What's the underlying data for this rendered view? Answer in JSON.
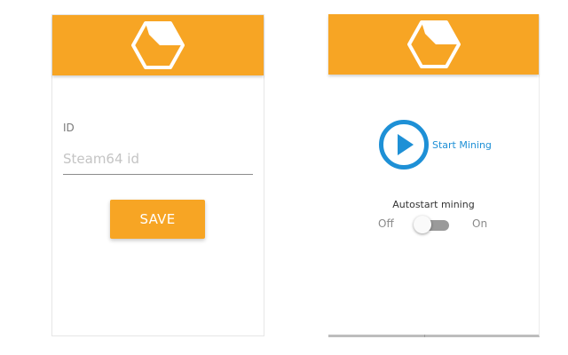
{
  "left_panel": {
    "logo_icon": "hexagon-cube-logo-icon",
    "id_label": "ID",
    "id_input": {
      "value": "",
      "placeholder": "Steam64 id"
    },
    "save_label": "SAVE"
  },
  "right_panel": {
    "logo_icon": "hexagon-cube-logo-icon",
    "start_icon": "play-circle-icon",
    "start_label": "Start Mining",
    "autostart": {
      "title": "Autostart mining",
      "off_label": "Off",
      "on_label": "On",
      "state": "off"
    }
  },
  "colors": {
    "header": "#f7a524",
    "accent_blue": "#1e90d6",
    "button": "#f7a524"
  }
}
